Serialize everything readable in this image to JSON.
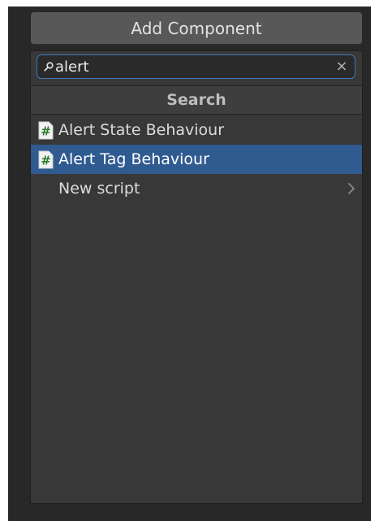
{
  "add_component": {
    "label": "Add Component"
  },
  "search": {
    "value": "alert",
    "placeholder": "",
    "clear_glyph": "×"
  },
  "section": {
    "title": "Search"
  },
  "results": [
    {
      "label": "Alert State Behaviour",
      "icon": "csharp-script-icon",
      "selected": false
    },
    {
      "label": "Alert Tag Behaviour",
      "icon": "csharp-script-icon",
      "selected": true
    }
  ],
  "new_script": {
    "label": "New script",
    "icon": "chevron-right-icon"
  },
  "colors": {
    "selection": "#2f5b91",
    "focus_border": "#3a79bb",
    "panel_bg": "#383838",
    "button_bg": "#585858",
    "script_icon_green": "#2d7a2d"
  }
}
